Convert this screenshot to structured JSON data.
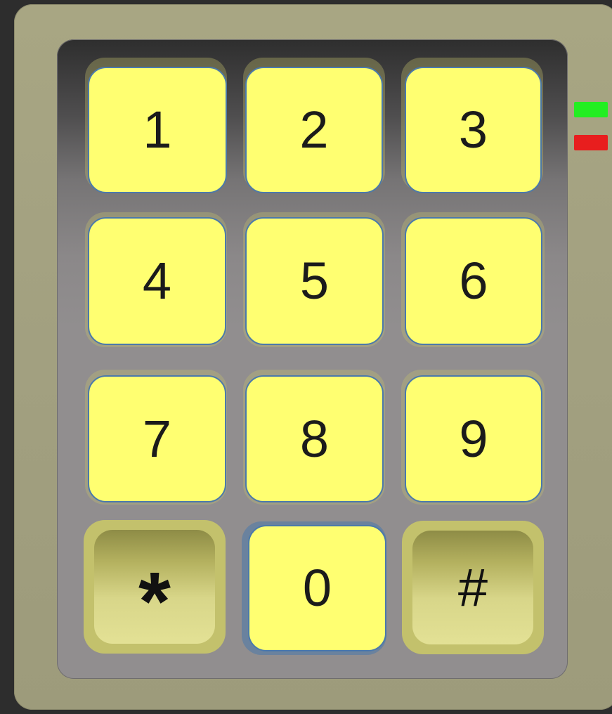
{
  "keypad": {
    "keys": {
      "k1": "1",
      "k2": "2",
      "k3": "3",
      "k4": "4",
      "k5": "5",
      "k6": "6",
      "k7": "7",
      "k8": "8",
      "k9": "9",
      "k0": "0",
      "star": "*",
      "hash": "#"
    }
  },
  "indicators": {
    "ready": {
      "icon": "led-green-icon",
      "color": "#22ee22"
    },
    "error": {
      "icon": "led-red-icon",
      "color": "#e81e1e"
    }
  },
  "colors": {
    "key_face": "#ffff71",
    "key_border": "#4b79ab",
    "special_key": "#c3c16c",
    "housing": "#a8a683"
  }
}
